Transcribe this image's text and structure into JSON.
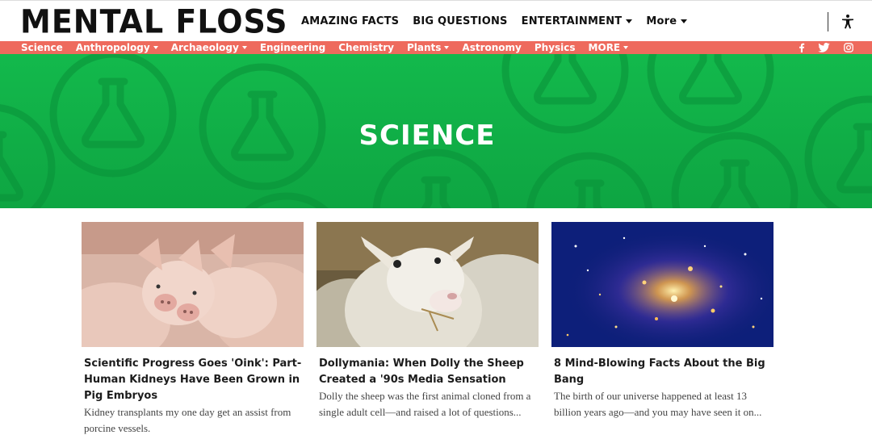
{
  "header": {
    "logo": "MENTAL FLOSS",
    "nav": [
      {
        "label": "AMAZING FACTS",
        "dropdown": false
      },
      {
        "label": "BIG QUESTIONS",
        "dropdown": false
      },
      {
        "label": "ENTERTAINMENT",
        "dropdown": true
      },
      {
        "label": "More",
        "dropdown": true
      }
    ],
    "accessibility_icon": "accessibility-icon"
  },
  "subnav": {
    "background": "#ee6a5d",
    "items": [
      {
        "label": "Science",
        "dropdown": false
      },
      {
        "label": "Anthropology",
        "dropdown": true
      },
      {
        "label": "Archaeology",
        "dropdown": true
      },
      {
        "label": "Engineering",
        "dropdown": false
      },
      {
        "label": "Chemistry",
        "dropdown": false
      },
      {
        "label": "Plants",
        "dropdown": true
      },
      {
        "label": "Astronomy",
        "dropdown": false
      },
      {
        "label": "Physics",
        "dropdown": false
      },
      {
        "label": "MORE",
        "dropdown": true
      }
    ],
    "social": [
      "facebook-icon",
      "twitter-icon",
      "instagram-icon"
    ]
  },
  "hero": {
    "title": "SCIENCE",
    "background": "#10b046",
    "pattern_icon": "flask-icon"
  },
  "articles": [
    {
      "title": "Scientific Progress Goes 'Oink': Part-Human Kidneys Have Been Grown in Pig Embryos",
      "description": "Kidney transplants my one day get an assist from porcine vessels.",
      "image": "pigs-photo"
    },
    {
      "title": "Dollymania: When Dolly the Sheep Created a '90s Media Sensation",
      "description": "Dolly the sheep was the first animal cloned from a single adult cell—and raised a lot of questions...",
      "image": "sheep-photo"
    },
    {
      "title": "8 Mind-Blowing Facts About the Big Bang",
      "description": "The birth of our universe happened at least 13 billion years ago—and you may have seen it on...",
      "image": "galaxy-cluster-photo"
    }
  ]
}
